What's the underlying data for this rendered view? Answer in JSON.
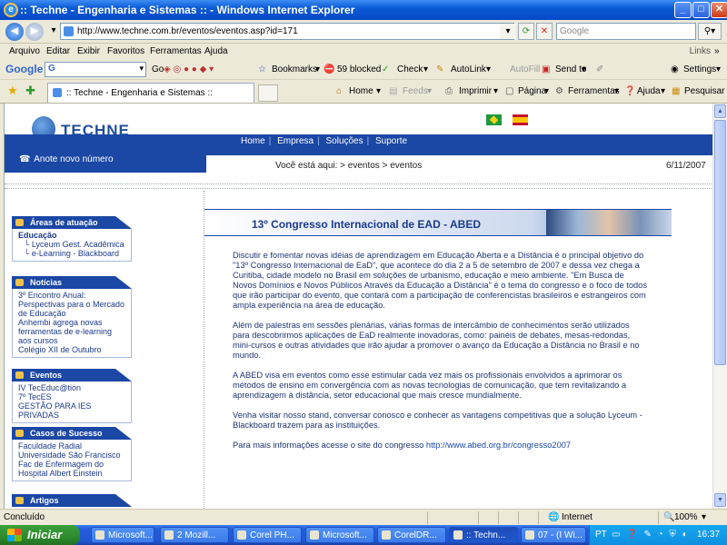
{
  "window": {
    "title": ":: Techne - Engenharia e Sistemas :: - Windows Internet Explorer"
  },
  "address": {
    "url": "http://www.techne.com.br/eventos/eventos.asp?id=171",
    "search_placeholder": "Google"
  },
  "menu": {
    "items": [
      "Arquivo",
      "Editar",
      "Exibir",
      "Favoritos",
      "Ferramentas",
      "Ajuda"
    ],
    "links": "Links"
  },
  "google_toolbar": {
    "brand": "Google",
    "go": "Go",
    "bookmarks": "Bookmarks",
    "blocked": "59 blocked",
    "check": "Check",
    "autolink": "AutoLink",
    "autofill": "AutoFill",
    "sendto": "Send to",
    "settings": "Settings"
  },
  "tab": {
    "title": ":: Techne - Engenharia e Sistemas ::"
  },
  "commands": {
    "home": "Home",
    "feeds": "Feeds",
    "print": "Imprimir",
    "page": "Página",
    "tools": "Ferramentas",
    "help": "Ajuda",
    "research": "Pesquisar"
  },
  "site": {
    "logo": "TECHNE",
    "nav": [
      "Home",
      "Empresa",
      "Soluções",
      "Suporte"
    ],
    "phone": "Anote novo número",
    "breadcrumb": "Você está aqui: > eventos > eventos",
    "date": "6/11/2007"
  },
  "sidebar": {
    "areas": {
      "title": "Áreas de atuação",
      "heading": "Educação",
      "items": [
        "Lyceum Gest. Acadêmica",
        "e-Learning - Blackboard"
      ]
    },
    "news": {
      "title": "Notícias",
      "items": [
        "3º Encontro Anual: Perspectivas para o Mercado de Educação",
        "Anhembi agrega novas ferramentas de e-learning aos cursos",
        "Colégio XII de Outubro"
      ]
    },
    "events": {
      "title": "Eventos",
      "items": [
        "IV TecEduc@tion",
        "7º TecES",
        "GESTÃO PARA IES PRIVADAS"
      ]
    },
    "cases": {
      "title": "Casos de Sucesso",
      "items": [
        "Faculdade Radial",
        "Universidade São Francisco",
        "Fac de Enfermagem do Hospital Albert Einstein"
      ]
    },
    "articles": {
      "title": "Artigos"
    }
  },
  "main": {
    "title": "13º Congresso Internacional de EAD - ABED",
    "paragraphs": [
      "Discutir e fomentar novas idéias de aprendizagem em Educação Aberta e a Distância é o principal objetivo do \"13º Congresso Internacional de EaD\", que acontece do dia 2 a 5 de setembro de 2007 e dessa vez chega a Curitiba, cidade modelo no Brasil em soluções de urbanismo, educação e meio ambiente. \"Em Busca de Novos Domínios e Novos Públicos Através da Educação a Distância\" é o tema do congresso e o foco de todos que irão participar do evento, que contará com a participação de conferencistas brasileiros e estrangeiros com ampla experiência na área de educação.",
      "Além de palestras em sessões plenárias, várias formas de intercâmbio de conhecimentos serão utilizados para descobrirmos aplicações de EaD realmente inovadoras, como: painéis de debates, mesas-redondas, mini-cursos e outras atividades que irão ajudar a promover o avanço da Educação a Distância no Brasil e no mundo.",
      "A ABED visa em eventos como esse estimular cada vez mais os profissionais envolvidos a aprimorar os métodos de ensino em convergência com as novas tecnologias de comunicação, que tem revitalizando a aprendizagem à distância, setor educacional que mais cresce mundialmente.",
      "Venha visitar nosso stand, conversar conosco e conhecer as vantagens competitivas que a solução Lyceum - Blackboard trazem para as instituições."
    ],
    "more_info": "Para mais informações acesse o site do congresso",
    "link": "http://www.abed.org.br/congresso2007"
  },
  "status": {
    "text": "Concluído",
    "zone": "Internet",
    "zoom": "100%"
  },
  "taskbar": {
    "start": "Iniciar",
    "tasks": [
      "Microsoft...",
      "2 Mozill...",
      "Corel PH...",
      "Microsoft...",
      "CorelDR...",
      ":: Techn...",
      "07 - (I Wi..."
    ],
    "lang": "PT",
    "time": "16:37"
  }
}
